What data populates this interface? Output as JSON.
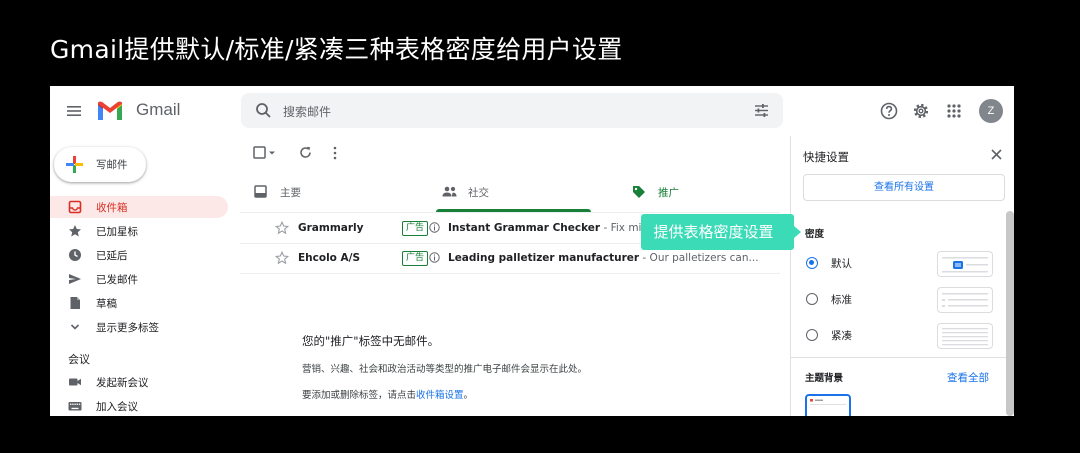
{
  "slide": {
    "title": "Gmail提供默认/标准/紧凑三种表格密度给用户设置"
  },
  "header": {
    "app_name": "Gmail",
    "search_placeholder": "搜索邮件",
    "avatar_letter": "Z",
    "icons": [
      "menu-icon",
      "gmail-logo",
      "search-icon",
      "tune-icon",
      "help-icon",
      "settings-icon",
      "apps-icon"
    ]
  },
  "sidebar": {
    "compose_label": "写邮件",
    "items": [
      {
        "label": "收件箱",
        "icon": "inbox-icon",
        "active": true
      },
      {
        "label": "已加星标",
        "icon": "star-icon"
      },
      {
        "label": "已延后",
        "icon": "clock-icon"
      },
      {
        "label": "已发邮件",
        "icon": "send-icon"
      },
      {
        "label": "草稿",
        "icon": "draft-icon"
      },
      {
        "label": "显示更多标签",
        "icon": "chevron-down-icon"
      }
    ],
    "meet_heading": "会议",
    "meet_items": [
      {
        "label": "发起新会议",
        "icon": "video-icon"
      },
      {
        "label": "加入会议",
        "icon": "keyboard-icon"
      }
    ]
  },
  "tabs": [
    {
      "label": "主要",
      "icon": "inbox-tab-icon"
    },
    {
      "label": "社交",
      "icon": "people-icon"
    },
    {
      "label": "推广",
      "icon": "tag-icon",
      "active": true
    }
  ],
  "emails": [
    {
      "sender": "Grammarly",
      "badge": "广告",
      "subject": "Instant Grammar Checker",
      "snippet": " - Fix misplace"
    },
    {
      "sender": "Ehcolo A/S",
      "badge": "广告",
      "subject": "Leading palletizer manufacturer",
      "snippet": " - Our palletizers can..."
    }
  ],
  "empty_state": {
    "title": "您的\"推广\"标签中无邮件。",
    "description": "营销、兴趣、社会和政治活动等类型的推广电子邮件会显示在此处。",
    "hint_prefix": "要添加或删除标签，请点击",
    "hint_link": "收件箱设置",
    "hint_suffix": "。"
  },
  "callout": {
    "text": "提供表格密度设置"
  },
  "quick_settings": {
    "title": "快捷设置",
    "see_all_button": "查看所有设置",
    "density_heading": "密度",
    "density_options": [
      {
        "label": "默认",
        "selected": true
      },
      {
        "label": "标准",
        "selected": false
      },
      {
        "label": "紧凑",
        "selected": false
      }
    ],
    "theme_heading": "主题背景",
    "theme_link": "查看全部"
  },
  "colors": {
    "accent": "#1a73e8",
    "callout": "#3cdbb8",
    "active_red": "#d93025",
    "promo_green": "#188038"
  }
}
